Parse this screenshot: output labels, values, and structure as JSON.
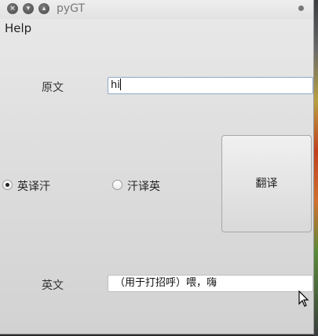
{
  "window": {
    "title": "pyGT"
  },
  "titlebar": {
    "close_icon": "×",
    "minimize_icon": "▾",
    "maximize_icon": "▴"
  },
  "menubar": {
    "help_label": "Help"
  },
  "source": {
    "label": "原文",
    "value": "hi"
  },
  "direction": {
    "options": [
      {
        "label": "英译汗",
        "selected": true
      },
      {
        "label": "汗译英",
        "selected": false
      }
    ]
  },
  "translate_button": {
    "label": "翻译"
  },
  "result": {
    "label": "英文",
    "value": "（用于打招呼）喂，嗨"
  }
}
